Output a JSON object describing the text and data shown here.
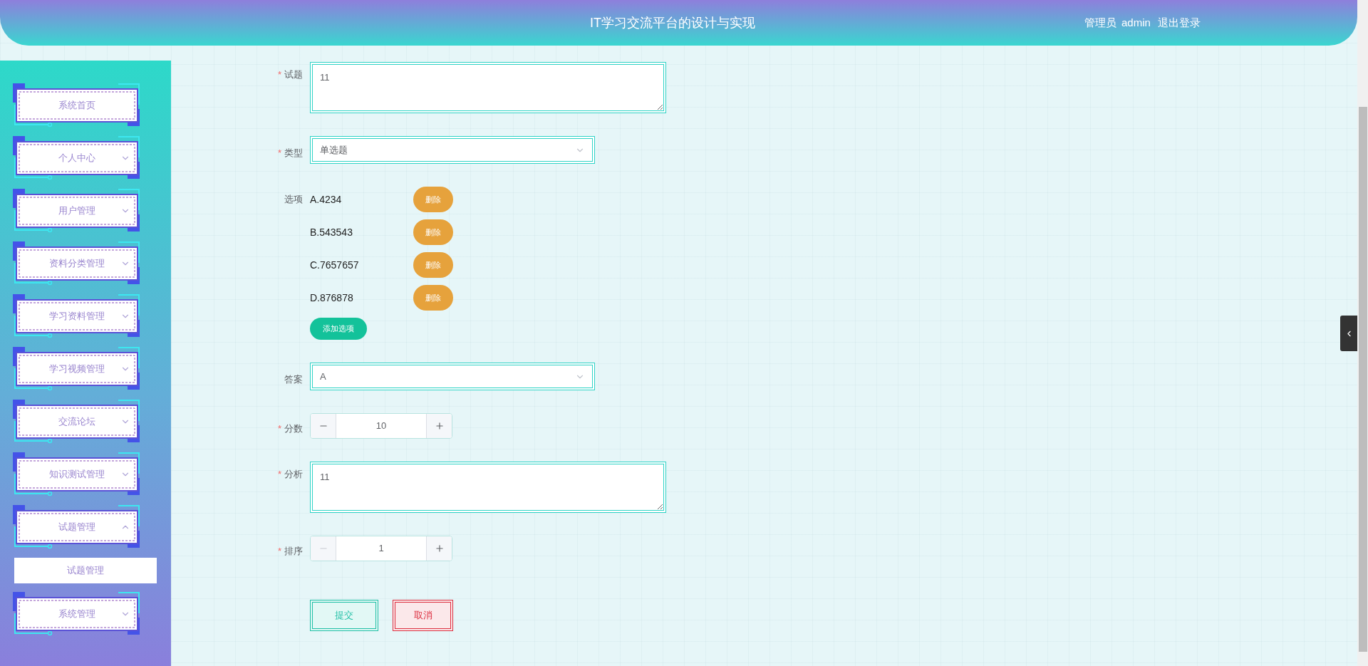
{
  "header": {
    "title": "IT学习交流平台的设计与实现",
    "role": "管理员",
    "username": "admin",
    "logout": "退出登录"
  },
  "sidebar": {
    "items": [
      {
        "kind": "link",
        "label": "系统首页"
      },
      {
        "kind": "menu",
        "label": "个人中心",
        "expanded": false
      },
      {
        "kind": "menu",
        "label": "用户管理",
        "expanded": false
      },
      {
        "kind": "menu",
        "label": "资料分类管理",
        "expanded": false
      },
      {
        "kind": "menu",
        "label": "学习资料管理",
        "expanded": false
      },
      {
        "kind": "menu",
        "label": "学习视频管理",
        "expanded": false
      },
      {
        "kind": "menu",
        "label": "交流论坛",
        "expanded": false
      },
      {
        "kind": "menu",
        "label": "知识测试管理",
        "expanded": false
      },
      {
        "kind": "menu",
        "label": "试题管理",
        "expanded": true,
        "children": [
          {
            "label": "试题管理"
          }
        ]
      },
      {
        "kind": "menu",
        "label": "系统管理",
        "expanded": false
      }
    ]
  },
  "form": {
    "fields": [
      {
        "kind": "textarea",
        "label": "试题",
        "required_mark": "*",
        "value": "11"
      },
      {
        "kind": "select",
        "label": "类型",
        "required_mark": "*",
        "value": "单选题"
      },
      {
        "kind": "options",
        "label": "选项",
        "options": [
          {
            "text": "A.4234",
            "delete_label": "删除"
          },
          {
            "text": "B.543543",
            "delete_label": "删除"
          },
          {
            "text": "C.7657657",
            "delete_label": "删除"
          },
          {
            "text": "D.876878",
            "delete_label": "删除"
          }
        ],
        "add_label": "添加选项"
      },
      {
        "kind": "select",
        "label": "答案",
        "value": "A"
      },
      {
        "kind": "number",
        "label": "分数",
        "required_mark": "*",
        "value": "10",
        "minus_disabled": false
      },
      {
        "kind": "textarea",
        "label": "分析",
        "required_mark": "*",
        "value": "11"
      },
      {
        "kind": "number",
        "label": "排序",
        "required_mark": "*",
        "value": "1",
        "minus_disabled": true
      }
    ],
    "buttons": [
      {
        "kind": "submit",
        "label": "提交"
      },
      {
        "kind": "cancel",
        "label": "取消"
      }
    ]
  }
}
